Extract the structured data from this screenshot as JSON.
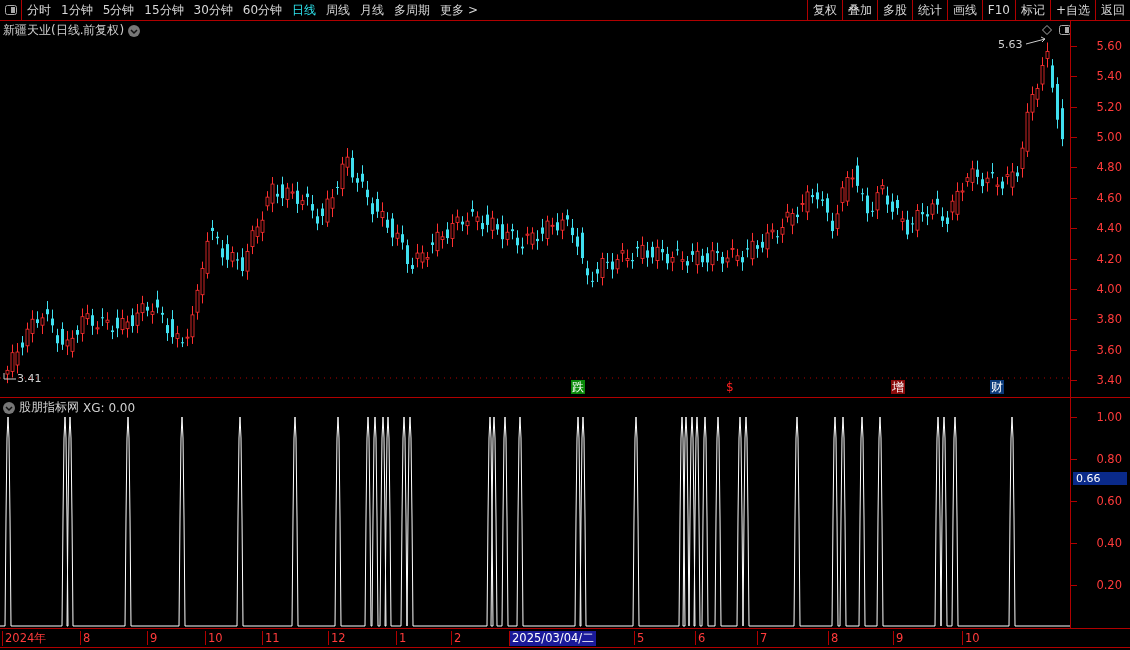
{
  "toolbar": {
    "periods": [
      {
        "label": "分时",
        "selected": false
      },
      {
        "label": "1分钟",
        "selected": false
      },
      {
        "label": "5分钟",
        "selected": false
      },
      {
        "label": "15分钟",
        "selected": false
      },
      {
        "label": "30分钟",
        "selected": false
      },
      {
        "label": "60分钟",
        "selected": false
      },
      {
        "label": "日线",
        "selected": true
      },
      {
        "label": "周线",
        "selected": false
      },
      {
        "label": "月线",
        "selected": false
      },
      {
        "label": "多周期",
        "selected": false
      },
      {
        "label": "更多 >",
        "selected": false
      }
    ],
    "actions": [
      "复权",
      "叠加",
      "多股",
      "统计",
      "画线",
      "F10",
      "标记",
      "+自选",
      "返回"
    ]
  },
  "main_chart": {
    "title": "新疆天业(日线.前复权)",
    "high_label": "5.63",
    "low_label": "3.41",
    "price_axis": [
      "5.60",
      "5.40",
      "5.20",
      "5.00",
      "4.80",
      "4.60",
      "4.40",
      "4.20",
      "4.00",
      "3.80",
      "3.60",
      "3.40"
    ],
    "markers": [
      {
        "kind": "fall",
        "label": "跌"
      },
      {
        "kind": "dollar",
        "label": "$"
      },
      {
        "kind": "increase",
        "label": "增"
      },
      {
        "kind": "finance",
        "label": "财"
      }
    ]
  },
  "indicator": {
    "title": "股朋指标网",
    "reading": "XG: 0.00",
    "axis": [
      "1.00",
      "0.80",
      "0.60",
      "0.40",
      "0.20"
    ],
    "current": "0.66"
  },
  "date_axis": [
    {
      "label": "2024年",
      "selected": false
    },
    {
      "label": "8",
      "selected": false
    },
    {
      "label": "9",
      "selected": false
    },
    {
      "label": "10",
      "selected": false
    },
    {
      "label": "11",
      "selected": false
    },
    {
      "label": "12",
      "selected": false
    },
    {
      "label": "1",
      "selected": false
    },
    {
      "label": "2",
      "selected": false
    },
    {
      "label": "2025/03/04/二",
      "selected": true
    },
    {
      "label": "5",
      "selected": false
    },
    {
      "label": "6",
      "selected": false
    },
    {
      "label": "7",
      "selected": false
    },
    {
      "label": "8",
      "selected": false
    },
    {
      "label": "9",
      "selected": false
    },
    {
      "label": "10",
      "selected": false
    }
  ]
}
